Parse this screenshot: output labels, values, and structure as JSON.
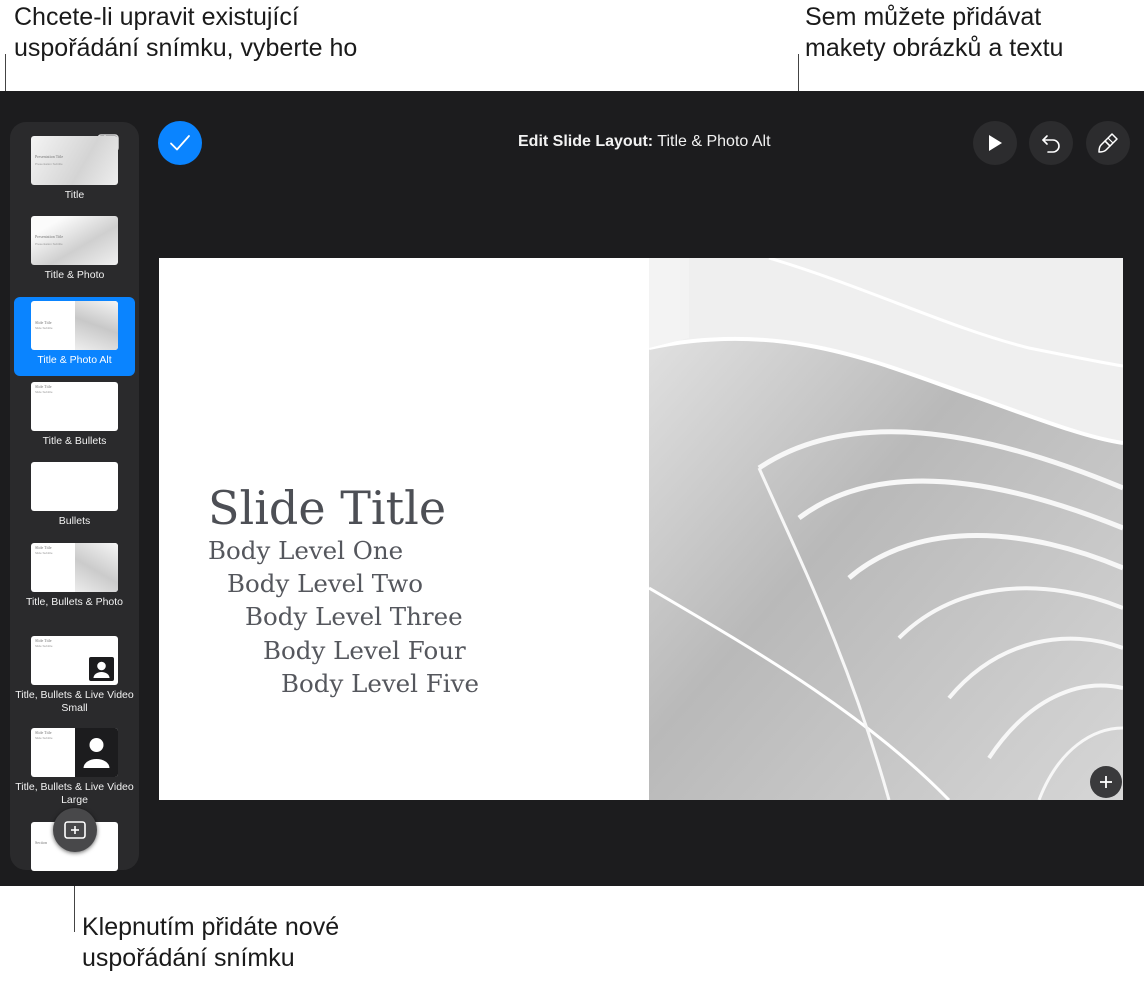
{
  "callouts": {
    "top_left": [
      "Chcete-li upravit existující",
      "uspořádání snímku, vyberte ho"
    ],
    "top_right": [
      "Sem můžete přidávat",
      "makety obrázků a textu"
    ],
    "bottom": [
      "Klepnutím přidáte nové",
      "uspořádání snímku"
    ]
  },
  "header": {
    "title_bold": "Edit Slide Layout:",
    "title_value": "Title & Photo Alt"
  },
  "icons": {
    "done": "checkmark-icon",
    "sidebar_toggle": "sidebar-icon",
    "play": "play-icon",
    "undo": "undo-icon",
    "format": "paintbrush-icon",
    "add": "plus-icon",
    "new_layout": "add-slide-icon"
  },
  "sidebar": {
    "layouts": [
      {
        "label": "Title",
        "selected": false
      },
      {
        "label": "Title & Photo",
        "selected": false
      },
      {
        "label": "Title & Photo Alt",
        "selected": true
      },
      {
        "label": "Title & Bullets",
        "selected": false
      },
      {
        "label": "Bullets",
        "selected": false
      },
      {
        "label": "Title, Bullets & Photo",
        "selected": false
      },
      {
        "label": "Title, Bullets & Live Video Small",
        "selected": false
      },
      {
        "label": "Title, Bullets & Live Video Large",
        "selected": false
      },
      {
        "label": "",
        "selected": false
      }
    ],
    "thumb_text": {
      "presentation_title": "Presentation Title",
      "presentation_subtitle": "Presentation Subtitle",
      "slide_title": "Slide Title",
      "slide_subtitle": "Slide Subtitle",
      "section": "Section"
    }
  },
  "slide": {
    "title": "Slide Title",
    "body_levels": [
      "Body Level One",
      "Body Level Two",
      "Body Level Three",
      "Body Level Four",
      "Body Level Five"
    ]
  },
  "colors": {
    "accent": "#0a84ff",
    "background": "#1c1c1e",
    "sidebar": "#2a2a2c"
  }
}
